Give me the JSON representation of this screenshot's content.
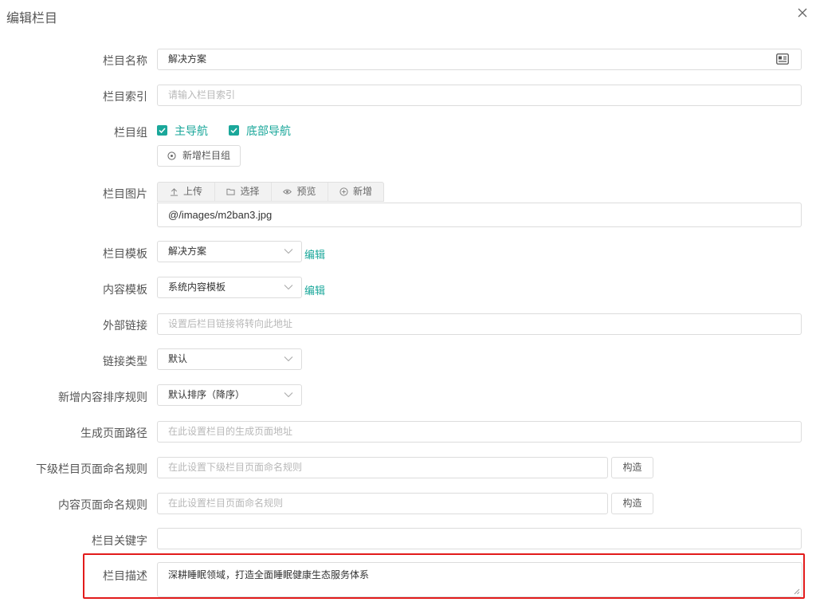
{
  "dialog": {
    "title": "编辑栏目",
    "close_icon": "close-icon"
  },
  "fields": {
    "name": {
      "label": "栏目名称",
      "value": "解决方案",
      "icon": "card-icon"
    },
    "index": {
      "label": "栏目索引",
      "placeholder": "请输入栏目索引"
    },
    "group": {
      "label": "栏目组",
      "options": [
        {
          "label": "主导航",
          "checked": true
        },
        {
          "label": "底部导航",
          "checked": true
        }
      ],
      "add_button": "新增栏目组"
    },
    "image": {
      "label": "栏目图片",
      "toolbar": [
        "上传",
        "选择",
        "预览",
        "新增"
      ],
      "value": "@/images/m2ban3.jpg"
    },
    "template": {
      "label": "栏目模板",
      "value": "解决方案",
      "edit": "编辑"
    },
    "content_template": {
      "label": "内容模板",
      "value": "系统内容模板",
      "edit": "编辑"
    },
    "external_link": {
      "label": "外部链接",
      "placeholder": "设置后栏目链接将转向此地址"
    },
    "link_type": {
      "label": "链接类型",
      "value": "默认"
    },
    "sort_rule": {
      "label": "新增内容排序规则",
      "value": "默认排序（降序）"
    },
    "page_path": {
      "label": "生成页面路径",
      "placeholder": "在此设置栏目的生成页面地址"
    },
    "sub_naming": {
      "label": "下级栏目页面命名规则",
      "placeholder": "在此设置下级栏目页面命名规则",
      "button": "构造"
    },
    "content_naming": {
      "label": "内容页面命名规则",
      "placeholder": "在此设置栏目页面命名规则",
      "button": "构造"
    },
    "keywords": {
      "label": "栏目关键字",
      "value": ""
    },
    "description": {
      "label": "栏目描述",
      "value": "深耕睡眠领域，打造全面睡眠健康生态服务体系"
    }
  },
  "colors": {
    "accent": "#1aa79a",
    "highlight": "#e21b1b"
  }
}
